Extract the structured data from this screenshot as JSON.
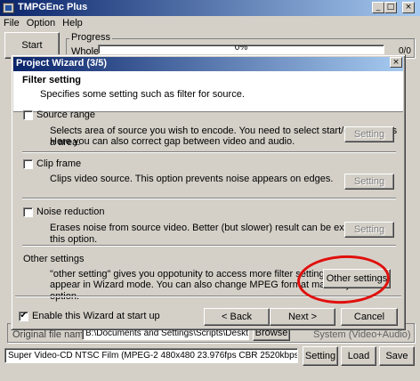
{
  "window": {
    "title": "TMPGEnc Plus",
    "minimize": "_",
    "maximize": "□",
    "close": "×"
  },
  "menu": {
    "file": "File",
    "option": "Option",
    "help": "Help"
  },
  "main": {
    "start_label": "Start",
    "progress_group": "Progress",
    "whole_label": "Whole",
    "progress_percent": "0%",
    "progress_value": 0,
    "original_file_label": "Original file name:",
    "original_file_value": "B:\\Documents and Settings\\Scripts\\Desktop\\hare",
    "browse_label": "Browse",
    "system_label": "System (Video+Audio)",
    "status_text": "Super Video-CD NTSC Film (MPEG-2 480x480 23.976fps CBR 2520kbps,  Layer-2 44100",
    "setting_label": "Setting",
    "load_label": "Load",
    "save_label": "Save"
  },
  "dialog": {
    "title": "Project Wizard (3/5)",
    "close": "×",
    "heading": "Filter setting",
    "subheading": "Specifies some setting such as filter for source.",
    "options": [
      {
        "label": "Source range",
        "desc1": "Selects area of source you wish to encode. You need to select start/end point as a area.",
        "desc2": "Here you can also correct gap between video and audio.",
        "button": "Setting",
        "checked": false
      },
      {
        "label": "Clip frame",
        "desc1": "Clips video source. This option prevents noise appears on edges.",
        "desc2": "",
        "button": "Setting",
        "checked": false
      },
      {
        "label": "Noise reduction",
        "desc1": "Erases noise from source video. Better (but slower) result can be expected with this option.",
        "desc2": "",
        "button": "Setting",
        "checked": false
      }
    ],
    "other": {
      "label": "Other settings",
      "desc1": "\"other setting\" gives you oppotunity to access more filter setting which do not",
      "desc2": "appear in Wizard mode. You can also change MPEG format manually in this option.",
      "button": "Other settings"
    },
    "enable_wizard_label": "Enable this Wizard at start up",
    "enable_wizard_checked": true,
    "back_label": "< Back",
    "next_label": "Next >",
    "cancel_label": "Cancel"
  },
  "annotation": {
    "color": "#e0100c"
  }
}
